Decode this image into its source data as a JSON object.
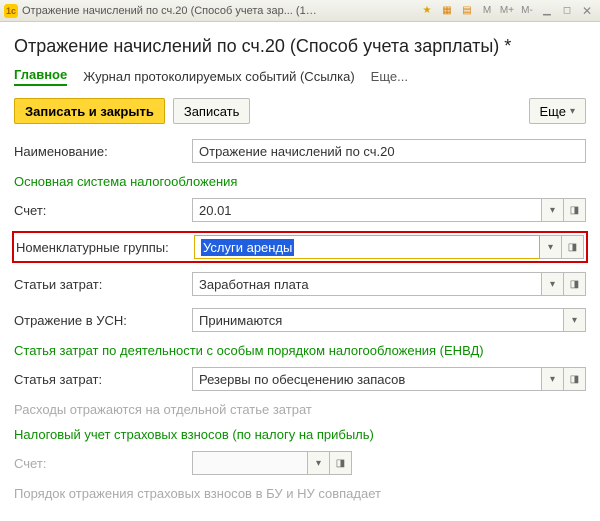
{
  "titlebar": {
    "title": "Отражение начислений по сч.20 (Способ учета зар...   (1С:Предприятие)",
    "m_buttons": [
      "M",
      "M+",
      "M-"
    ]
  },
  "page": {
    "title": "Отражение начислений по сч.20 (Способ учета зарплаты) *"
  },
  "tabs": {
    "main": "Главное",
    "journal": "Журнал протоколируемых событий (Ссылка)",
    "more": "Еще..."
  },
  "toolbar": {
    "write_close": "Записать и закрыть",
    "write": "Записать",
    "more": "Еще"
  },
  "fields": {
    "name_label": "Наименование:",
    "name_value": "Отражение начислений по сч.20",
    "section_main_tax": "Основная система налогообложения",
    "account_label": "Счет:",
    "account_value": "20.01",
    "nomen_label": "Номенклатурные группы:",
    "nomen_value": "Услуги аренды",
    "cost_label": "Статьи затрат:",
    "cost_value": "Заработная плата",
    "usn_label": "Отражение в УСН:",
    "usn_value": "Принимаются",
    "section_envd": "Статья затрат по деятельности с особым порядком налогообложения (ЕНВД)",
    "cost2_label": "Статья затрат:",
    "cost2_value": "Резервы по обесценению запасов",
    "note_envd": "Расходы отражаются на отдельной статье затрат",
    "section_insurance": "Налоговый учет страховых взносов (по налогу на прибыль)",
    "account2_label": "Счет:",
    "account2_value": "",
    "note_insurance": "Порядок отражения страховых взносов в БУ и НУ совпадает"
  }
}
